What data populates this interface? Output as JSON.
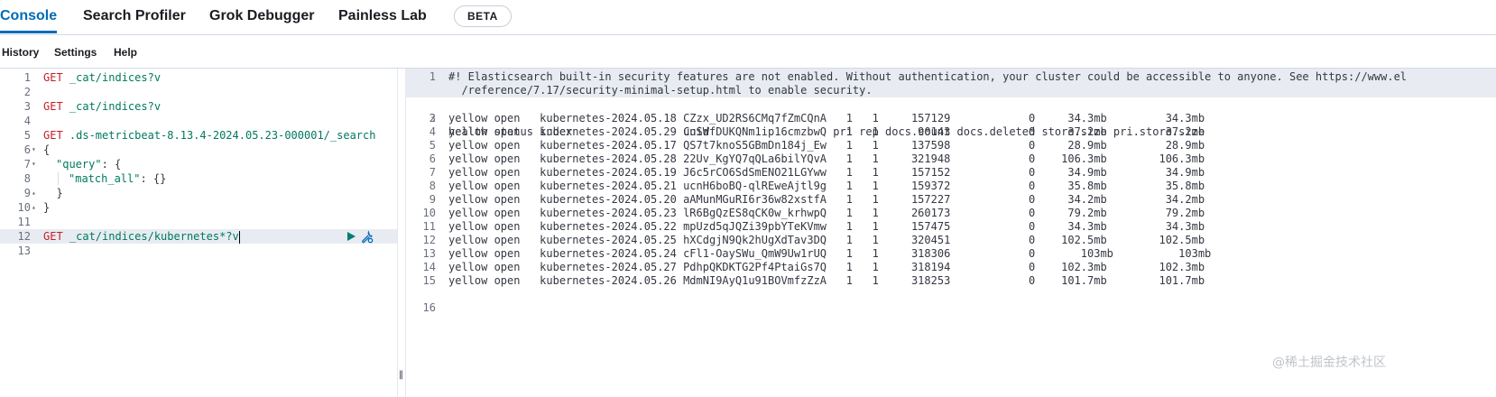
{
  "tabs": {
    "console": "Console",
    "search_profiler": "Search Profiler",
    "grok_debugger": "Grok Debugger",
    "painless_lab": "Painless Lab",
    "beta_badge": "BETA"
  },
  "menu": {
    "history": "History",
    "settings": "Settings",
    "help": "Help"
  },
  "editor": {
    "lines": [
      {
        "n": "1",
        "method": "GET",
        "url": " _cat/indices?v"
      },
      {
        "n": "2"
      },
      {
        "n": "3",
        "method": "GET",
        "url": " _cat/indices?v"
      },
      {
        "n": "4"
      },
      {
        "n": "5",
        "method": "GET",
        "url": " .ds-metricbeat-8.13.4-2024.05.23-000001/_search"
      },
      {
        "n": "6",
        "code": "{"
      },
      {
        "n": "7",
        "key": "\"query\"",
        "rest": ": {"
      },
      {
        "n": "8",
        "key": "\"match_all\"",
        "rest": ": {}"
      },
      {
        "n": "9",
        "code": "  }"
      },
      {
        "n": "10",
        "code": "}"
      },
      {
        "n": "11"
      },
      {
        "n": "12",
        "method": "GET",
        "url": " _cat/indices/kubernetes*?v"
      },
      {
        "n": "13"
      }
    ]
  },
  "output": {
    "warning_line1": "#! Elasticsearch built-in security features are not enabled. Without authentication, your cluster could be accessible to anyone. See https://www.el",
    "warning_line2": "  /reference/7.17/security-minimal-setup.html to enable security.",
    "header": "health status index                 uuid                   pri rep docs.count docs.deleted store.size pri.store.size",
    "rows": [
      "yellow open   kubernetes-2024.05.18 CZzx_UD2RS6CMq7fZmCQnA   1   1     157129            0     34.3mb         34.3mb",
      "yellow open   kubernetes-2024.05.29 CnSWfDUKQNm1ip16cmzbwQ   1   1      90143            0     37.2mb         37.2mb",
      "yellow open   kubernetes-2024.05.17 QS7t7knoS5GBmDn184j_Ew   1   1     137598            0     28.9mb         28.9mb",
      "yellow open   kubernetes-2024.05.28 22Uv_KgYQ7qQLa6bilYQvA   1   1     321948            0    106.3mb        106.3mb",
      "yellow open   kubernetes-2024.05.19 J6c5rCO6SdSmENO21LGYww   1   1     157152            0     34.9mb         34.9mb",
      "yellow open   kubernetes-2024.05.21 ucnH6boBQ-qlREweAjtl9g   1   1     159372            0     35.8mb         35.8mb",
      "yellow open   kubernetes-2024.05.20 aAMunMGuRI6r36w82xstfA   1   1     157227            0     34.2mb         34.2mb",
      "yellow open   kubernetes-2024.05.23 lR6BgQzES8qCK0w_krhwpQ   1   1     260173            0     79.2mb         79.2mb",
      "yellow open   kubernetes-2024.05.22 mpUzd5qJQZi39pbYTeKVmw   1   1     157475            0     34.3mb         34.3mb",
      "yellow open   kubernetes-2024.05.25 hXCdgjN9Qk2hUgXdTav3DQ   1   1     320451            0    102.5mb        102.5mb",
      "yellow open   kubernetes-2024.05.24 cFl1-OaySWu_QmW9Uw1rUQ   1   1     318306            0       103mb          103mb",
      "yellow open   kubernetes-2024.05.27 PdhpQKDKTG2Pf4PtaiGs7Q   1   1     318194            0    102.3mb        102.3mb",
      "yellow open   kubernetes-2024.05.26 MdmNI9AyQ1u91BOVmfzZzA   1   1     318253            0    101.7mb        101.7mb"
    ]
  },
  "watermark": "@稀土掘金技术社区",
  "colors": {
    "accent": "#006bb8",
    "method": "#c61e25",
    "url": "#00795e"
  }
}
